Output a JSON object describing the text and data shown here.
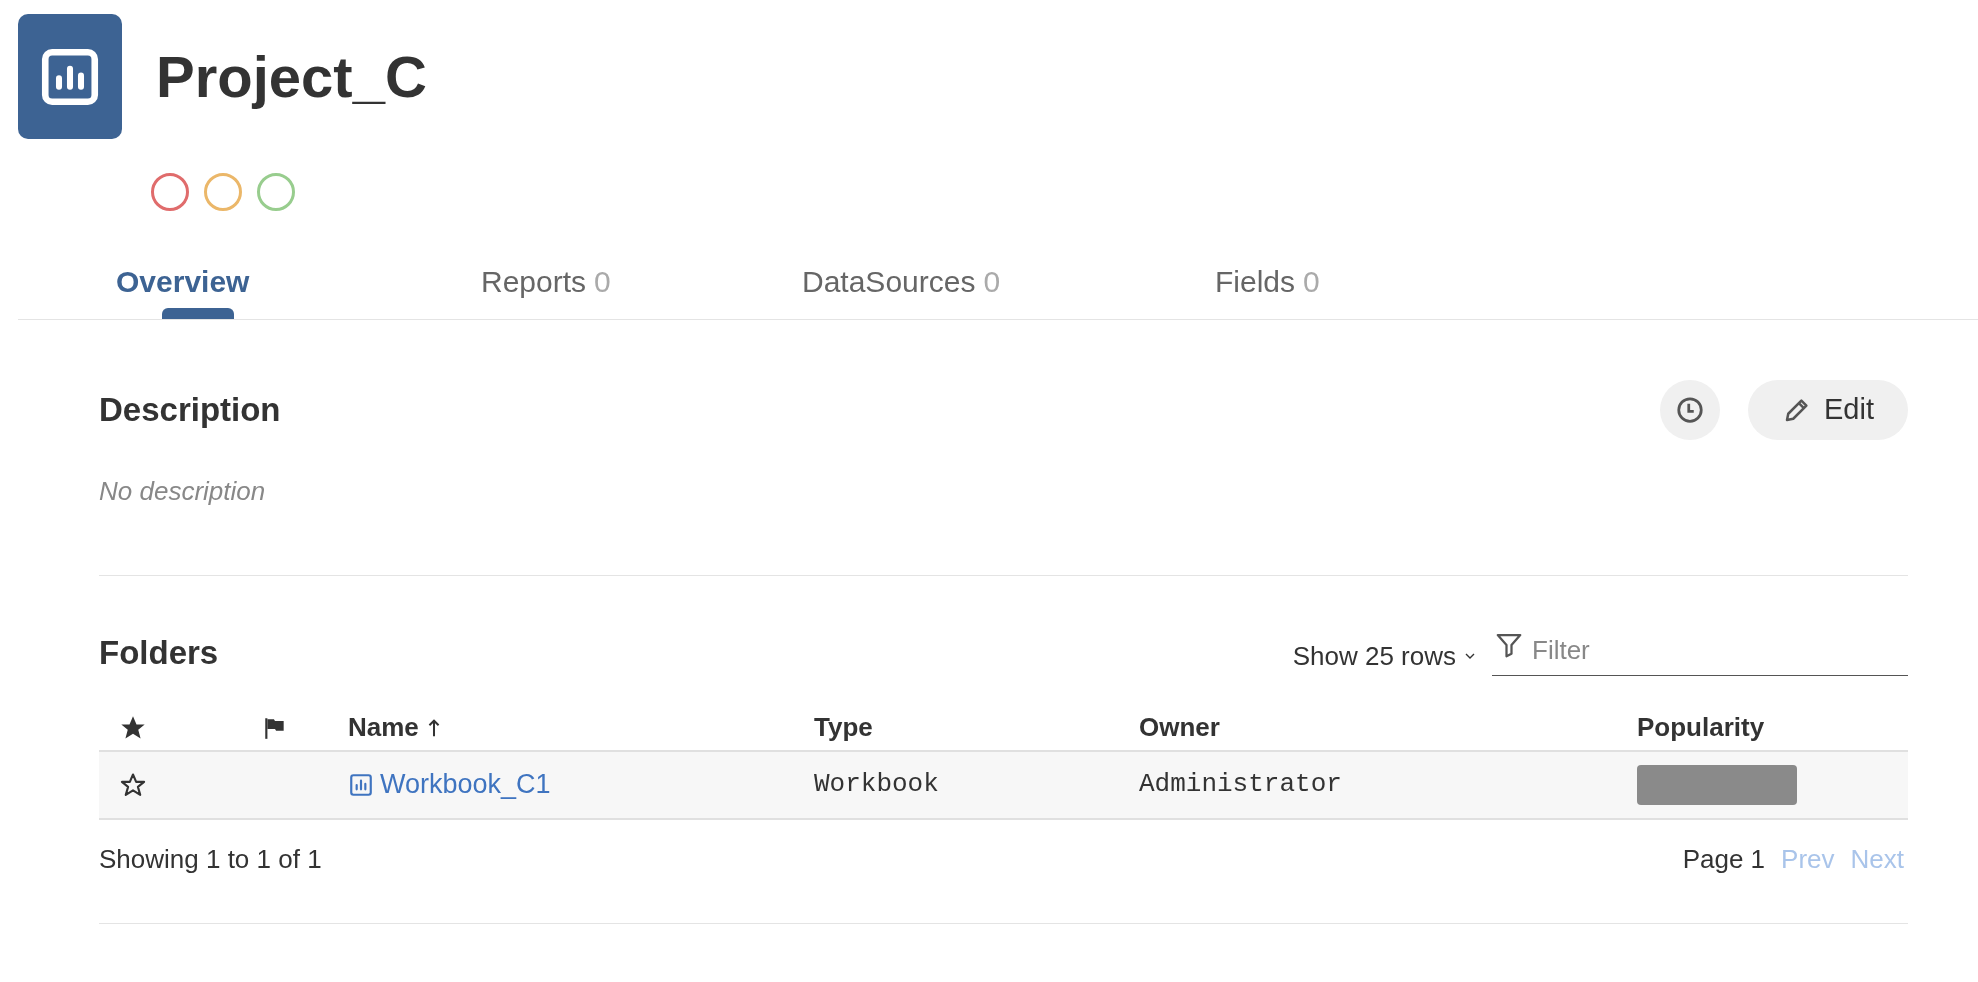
{
  "project": {
    "title": "Project_C"
  },
  "status_circles": [
    {
      "color": "#e06c6c"
    },
    {
      "color": "#ebb769"
    },
    {
      "color": "#98cd8e"
    }
  ],
  "tabs": [
    {
      "label": "Overview",
      "selected": true
    },
    {
      "label": "Reports",
      "count": "0",
      "selected": false
    },
    {
      "label": "DataSources",
      "count": "0",
      "selected": false
    },
    {
      "label": "Fields",
      "count": "0",
      "selected": false
    }
  ],
  "description": {
    "heading": "Description",
    "text": "No description",
    "edit_button": "Edit"
  },
  "folders": {
    "heading": "Folders",
    "rows_select": "Show 25 rows",
    "filter_placeholder": "Filter",
    "columns": [
      {
        "kind": "star"
      },
      {
        "kind": "flag"
      },
      {
        "kind": "text",
        "label": "Name",
        "sorted": true
      },
      {
        "kind": "text",
        "label": "Type",
        "sorted": false
      },
      {
        "kind": "text",
        "label": "Owner",
        "sorted": false
      },
      {
        "kind": "text",
        "label": "Popularity",
        "sorted": false
      }
    ],
    "rows": [
      {
        "starred": false,
        "name": "Workbook_C1",
        "type": "Workbook",
        "owner": "Administrator"
      }
    ],
    "summary": "Showing 1 to 1 of 1",
    "page": "Page 1",
    "pager": [
      {
        "label": "Prev",
        "disabled": true
      },
      {
        "label": "Next",
        "disabled": true
      }
    ]
  }
}
